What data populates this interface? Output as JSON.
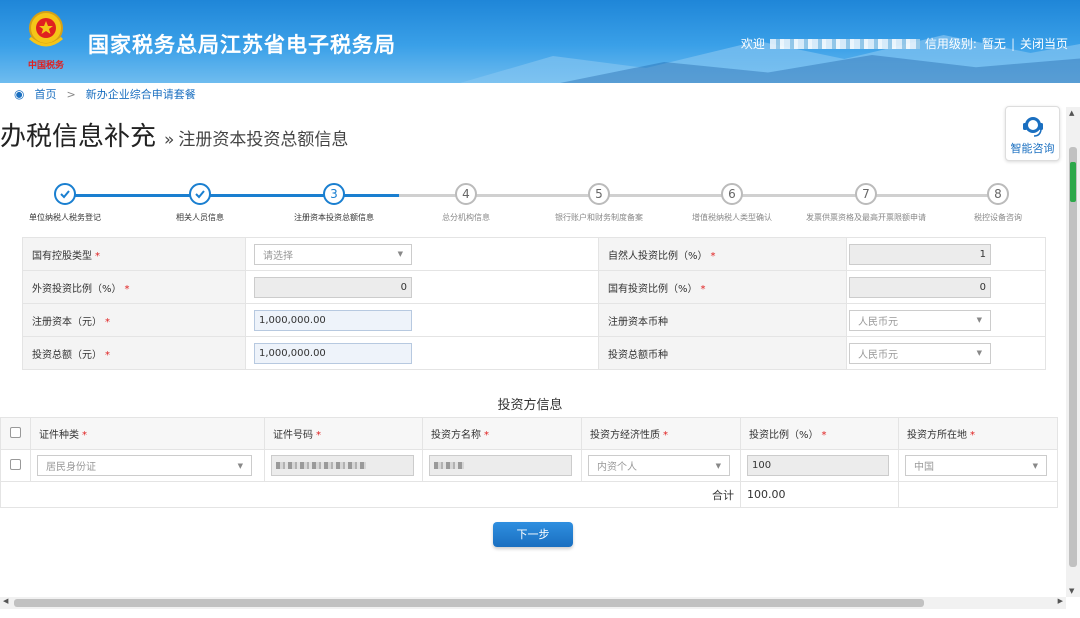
{
  "header": {
    "site_title": "国家税务总局江苏省电子税务局",
    "logo_text": "中国税务",
    "welcome_label": "欢迎",
    "credit_label": "信用级别:",
    "credit_value": "暂无",
    "separator": "|",
    "close_label": "关闭当页"
  },
  "breadcrumb": {
    "home": "首页",
    "separator": ">",
    "current": "新办企业综合申请套餐"
  },
  "page": {
    "title": "办税信息补充",
    "sep": "»",
    "subtitle": "注册资本投资总额信息"
  },
  "consult": {
    "label": "智能咨询"
  },
  "steps": [
    {
      "num": "1",
      "label": "单位纳税人税务登记",
      "state": "done"
    },
    {
      "num": "2",
      "label": "相关人员信息",
      "state": "done"
    },
    {
      "num": "3",
      "label": "注册资本投资总额信息",
      "state": "current"
    },
    {
      "num": "4",
      "label": "总分机构信息",
      "state": "todo"
    },
    {
      "num": "5",
      "label": "银行账户和财务制度备案",
      "state": "todo"
    },
    {
      "num": "6",
      "label": "增值税纳税人类型确认",
      "state": "todo"
    },
    {
      "num": "7",
      "label": "发票供票资格及最高开票限额申请",
      "state": "todo"
    },
    {
      "num": "8",
      "label": "税控设备咨询",
      "state": "todo"
    }
  ],
  "form": {
    "state_control_label": "国有控股类型",
    "state_control_placeholder": "请选择",
    "natural_ratio_label": "自然人投资比例（%）",
    "natural_ratio_value": "1",
    "foreign_ratio_label": "外资投资比例（%）",
    "foreign_ratio_value": "0",
    "state_ratio_label": "国有投资比例（%）",
    "state_ratio_value": "0",
    "reg_capital_label": "注册资本（元）",
    "reg_capital_value": "1,000,000.00",
    "reg_currency_label": "注册资本币种",
    "reg_currency_value": "人民币元",
    "total_invest_label": "投资总额（元）",
    "total_invest_value": "1,000,000.00",
    "invest_currency_label": "投资总额币种",
    "invest_currency_value": "人民币元",
    "required_mark": "*"
  },
  "investor": {
    "section_title": "投资方信息",
    "headers": [
      "证件种类",
      "证件号码",
      "投资方名称",
      "投资方经济性质",
      "投资比例（%）",
      "投资方所在地"
    ],
    "row": {
      "id_type": "居民身份证",
      "nature": "内资个人",
      "ratio": "100",
      "location": "中国"
    },
    "sum_label": "合计",
    "sum_value": "100.00"
  },
  "buttons": {
    "next": "下一步"
  }
}
